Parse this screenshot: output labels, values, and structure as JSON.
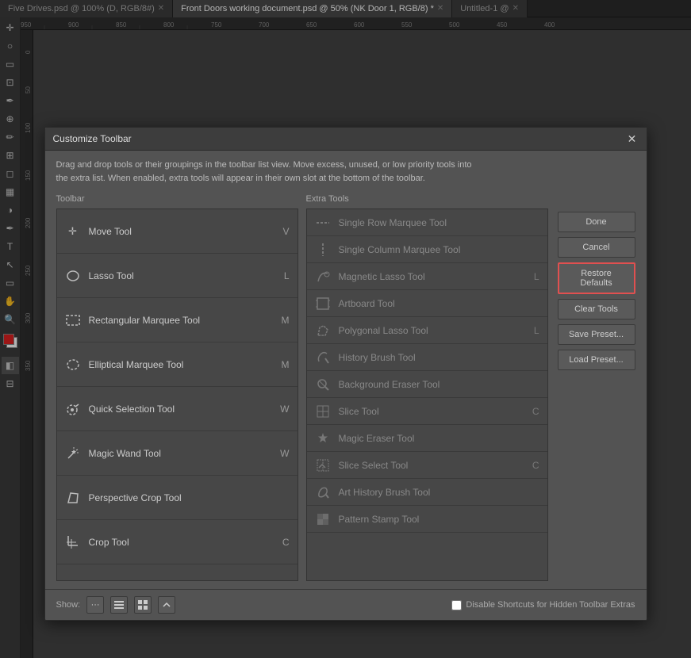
{
  "tabs": [
    {
      "label": "Five Drives.psd @ 100% (D, RGB/8#)",
      "active": false,
      "id": "tab1"
    },
    {
      "label": "Front Doors working document.psd @ 50% (NK Door 1, RGB/8) *",
      "active": true,
      "id": "tab2"
    },
    {
      "label": "Untitled-1 @",
      "active": false,
      "id": "tab3"
    }
  ],
  "dialog": {
    "title": "Customize Toolbar",
    "instruction": "Drag and drop tools or their groupings in the toolbar list view. Move excess, unused, or low priority tools into\nthe extra list. When enabled, extra tools will appear in their own slot at the bottom of the toolbar.",
    "toolbar_label": "Toolbar",
    "extra_label": "Extra Tools",
    "toolbar_items": [
      {
        "name": "Move Tool",
        "shortcut": "V",
        "icon": "✛"
      },
      {
        "name": "Lasso Tool",
        "shortcut": "L",
        "icon": "○"
      },
      {
        "name": "Rectangular Marquee Tool",
        "shortcut": "M",
        "icon": "▭"
      },
      {
        "name": "Elliptical Marquee Tool",
        "shortcut": "M",
        "icon": "◯"
      },
      {
        "name": "Quick Selection Tool",
        "shortcut": "W",
        "icon": "⊕"
      },
      {
        "name": "Magic Wand Tool",
        "shortcut": "W",
        "icon": "✦"
      },
      {
        "name": "Perspective Crop Tool",
        "shortcut": "",
        "icon": "⊞"
      },
      {
        "name": "Crop Tool",
        "shortcut": "C",
        "icon": "⊡"
      }
    ],
    "extra_items": [
      {
        "name": "Single Row Marquee Tool",
        "shortcut": "",
        "icon": "—"
      },
      {
        "name": "Single Column Marquee Tool",
        "shortcut": "",
        "icon": "|"
      },
      {
        "name": "Magnetic Lasso Tool",
        "shortcut": "L",
        "icon": "⌀"
      },
      {
        "name": "Artboard Tool",
        "shortcut": "",
        "icon": "⊟"
      },
      {
        "name": "Polygonal Lasso Tool",
        "shortcut": "L",
        "icon": "⌖"
      },
      {
        "name": "History Brush Tool",
        "shortcut": "",
        "icon": "⟳"
      },
      {
        "name": "Background Eraser Tool",
        "shortcut": "",
        "icon": "✂"
      },
      {
        "name": "Slice Tool",
        "shortcut": "C",
        "icon": "⋯"
      },
      {
        "name": "Magic Eraser Tool",
        "shortcut": "",
        "icon": "✦"
      },
      {
        "name": "Slice Select Tool",
        "shortcut": "C",
        "icon": "⋯"
      },
      {
        "name": "Art History Brush Tool",
        "shortcut": "",
        "icon": "⟳"
      },
      {
        "name": "Pattern Stamp Tool",
        "shortcut": "",
        "icon": "⊕"
      }
    ],
    "buttons": {
      "done": "Done",
      "cancel": "Cancel",
      "restore_defaults": "Restore Defaults",
      "clear_tools": "Clear Tools",
      "save_preset": "Save Preset...",
      "load_preset": "Load Preset..."
    },
    "footer": {
      "show_label": "Show:",
      "disable_label": "Disable Shortcuts for Hidden Toolbar Extras"
    }
  }
}
